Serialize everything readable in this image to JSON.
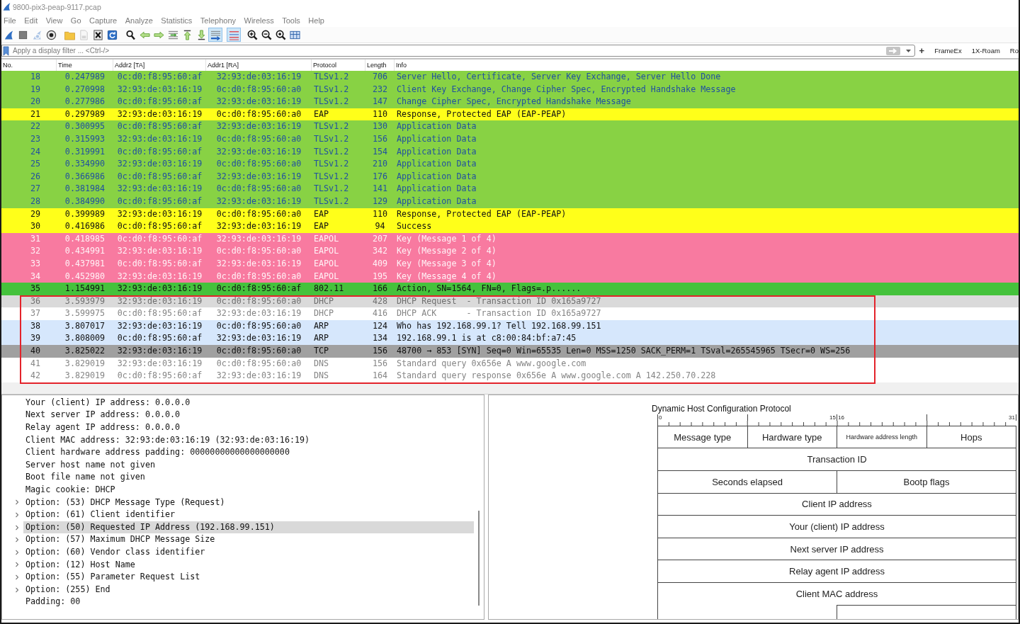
{
  "window": {
    "title": "9800-pix3-peap-9117.pcap"
  },
  "menu": [
    "File",
    "Edit",
    "View",
    "Go",
    "Capture",
    "Analyze",
    "Statistics",
    "Telephony",
    "Wireless",
    "Tools",
    "Help"
  ],
  "toolbar": [
    [
      {
        "on": false,
        "disabled": false
      },
      {
        "on": false,
        "disabled": false
      },
      {
        "on": false,
        "disabled": true
      },
      {
        "on": false,
        "disabled": false
      }
    ],
    [
      {
        "on": false,
        "disabled": false
      },
      {
        "on": false,
        "disabled": true
      },
      {
        "on": false,
        "disabled": false
      },
      {
        "on": false,
        "disabled": false
      }
    ],
    [
      {
        "on": false,
        "disabled": false
      },
      {
        "on": false,
        "disabled": false
      },
      {
        "on": false,
        "disabled": false
      },
      {
        "on": false,
        "disabled": false
      },
      {
        "on": false,
        "disabled": false
      },
      {
        "on": false,
        "disabled": false
      },
      {
        "on": true,
        "disabled": false
      }
    ],
    [
      {
        "on": true,
        "disabled": false
      }
    ],
    [
      {
        "on": false,
        "disabled": false
      },
      {
        "on": false,
        "disabled": false
      },
      {
        "on": false,
        "disabled": false
      },
      {
        "on": false,
        "disabled": false
      }
    ]
  ],
  "filter": {
    "placeholder": "Apply a display filter ... <Ctrl-/>",
    "add_button": "+",
    "buttons": [
      "FrameEx",
      "1X-Roam",
      "Ro"
    ]
  },
  "packet_list": {
    "columns": [
      "No.",
      "Time",
      "Addr2 [TA]",
      "Addr1 [RA]",
      "Protocol",
      "Length",
      "Info"
    ],
    "rows": [
      {
        "cells": [
          "18",
          "0.247989",
          "0c:d0:f8:95:60:af",
          "32:93:de:03:16:19",
          "TLSv1.2",
          "706",
          "Server Hello, Certificate, Server Key Exchange, Server Hello Done"
        ],
        "color": "#88d244",
        "selected": false
      },
      {
        "cells": [
          "19",
          "0.270998",
          "32:93:de:03:16:19",
          "0c:d0:f8:95:60:a0",
          "TLSv1.2",
          "232",
          "Client Key Exchange, Change Cipher Spec, Encrypted Handshake Message"
        ],
        "color": "#88d244",
        "selected": false
      },
      {
        "cells": [
          "20",
          "0.277986",
          "0c:d0:f8:95:60:af",
          "32:93:de:03:16:19",
          "TLSv1.2",
          "147",
          "Change Cipher Spec, Encrypted Handshake Message"
        ],
        "color": "#88d244",
        "selected": false
      },
      {
        "cells": [
          "21",
          "0.297989",
          "32:93:de:03:16:19",
          "0c:d0:f8:95:60:a0",
          "EAP",
          "110",
          "Response, Protected EAP (EAP-PEAP)"
        ],
        "color": "#ffff1a",
        "selected": false
      },
      {
        "cells": [
          "22",
          "0.300995",
          "0c:d0:f8:95:60:af",
          "32:93:de:03:16:19",
          "TLSv1.2",
          "130",
          "Application Data"
        ],
        "color": "#88d244",
        "selected": false
      },
      {
        "cells": [
          "23",
          "0.315993",
          "32:93:de:03:16:19",
          "0c:d0:f8:95:60:a0",
          "TLSv1.2",
          "156",
          "Application Data"
        ],
        "color": "#88d244",
        "selected": false
      },
      {
        "cells": [
          "24",
          "0.319991",
          "0c:d0:f8:95:60:af",
          "32:93:de:03:16:19",
          "TLSv1.2",
          "154",
          "Application Data"
        ],
        "color": "#88d244",
        "selected": false
      },
      {
        "cells": [
          "25",
          "0.334990",
          "32:93:de:03:16:19",
          "0c:d0:f8:95:60:a0",
          "TLSv1.2",
          "210",
          "Application Data"
        ],
        "color": "#88d244",
        "selected": false
      },
      {
        "cells": [
          "26",
          "0.366986",
          "0c:d0:f8:95:60:af",
          "32:93:de:03:16:19",
          "TLSv1.2",
          "176",
          "Application Data"
        ],
        "color": "#88d244",
        "selected": false
      },
      {
        "cells": [
          "27",
          "0.381984",
          "32:93:de:03:16:19",
          "0c:d0:f8:95:60:a0",
          "TLSv1.2",
          "141",
          "Application Data"
        ],
        "color": "#88d244",
        "selected": false
      },
      {
        "cells": [
          "28",
          "0.384990",
          "0c:d0:f8:95:60:af",
          "32:93:de:03:16:19",
          "TLSv1.2",
          "129",
          "Application Data"
        ],
        "color": "#88d244",
        "selected": false
      },
      {
        "cells": [
          "29",
          "0.399989",
          "32:93:de:03:16:19",
          "0c:d0:f8:95:60:a0",
          "EAP",
          "110",
          "Response, Protected EAP (EAP-PEAP)"
        ],
        "color": "#ffff1a",
        "selected": false
      },
      {
        "cells": [
          "30",
          "0.416986",
          "0c:d0:f8:95:60:af",
          "32:93:de:03:16:19",
          "EAP",
          "94",
          "Success"
        ],
        "color": "#ffff1a",
        "selected": false
      },
      {
        "cells": [
          "31",
          "0.418985",
          "0c:d0:f8:95:60:af",
          "32:93:de:03:16:19",
          "EAPOL",
          "207",
          "Key (Message 1 of 4)"
        ],
        "color": "#f87aa0",
        "selected": false
      },
      {
        "cells": [
          "32",
          "0.434991",
          "32:93:de:03:16:19",
          "0c:d0:f8:95:60:a0",
          "EAPOL",
          "342",
          "Key (Message 2 of 4)"
        ],
        "color": "#f87aa0",
        "selected": false
      },
      {
        "cells": [
          "33",
          "0.437981",
          "0c:d0:f8:95:60:af",
          "32:93:de:03:16:19",
          "EAPOL",
          "409",
          "Key (Message 3 of 4)"
        ],
        "color": "#f87aa0",
        "selected": false
      },
      {
        "cells": [
          "34",
          "0.452980",
          "32:93:de:03:16:19",
          "0c:d0:f8:95:60:a0",
          "EAPOL",
          "195",
          "Key (Message 4 of 4)"
        ],
        "color": "#f87aa0",
        "selected": false
      },
      {
        "cells": [
          "35",
          "1.154991",
          "32:93:de:03:16:19",
          "0c:d0:f8:95:60:af",
          "802.11",
          "166",
          "Action, SN=1564, FN=0, Flags=.p......"
        ],
        "color": "#45c23c",
        "selected": false
      }
    ],
    "framed_rows": [
      {
        "cells": [
          "36",
          "3.593979",
          "32:93:de:03:16:19",
          "0c:d0:f8:95:60:a0",
          "DHCP",
          "428",
          "DHCP Request  - Transaction ID 0x165a9727"
        ],
        "selected": true
      },
      {
        "cells": [
          "37",
          "3.599975",
          "0c:d0:f8:95:60:af",
          "32:93:de:03:16:19",
          "DHCP",
          "416",
          "DHCP ACK      - Transaction ID 0x165a9727"
        ],
        "color": "#ffffff",
        "selected": false
      },
      {
        "cells": [
          "38",
          "3.807017",
          "32:93:de:03:16:19",
          "0c:d0:f8:95:60:a0",
          "ARP",
          "124",
          "Who has 192.168.99.1? Tell 192.168.99.151"
        ],
        "color": "#d6e7fc",
        "selected": false
      },
      {
        "cells": [
          "39",
          "3.808009",
          "0c:d0:f8:95:60:af",
          "32:93:de:03:16:19",
          "ARP",
          "134",
          "192.168.99.1 is at c8:00:84:bf:a7:45"
        ],
        "color": "#d6e7fc",
        "selected": false
      },
      {
        "cells": [
          "40",
          "3.825022",
          "32:93:de:03:16:19",
          "0c:d0:f8:95:60:a0",
          "TCP",
          "156",
          "48700 → 853 [SYN] Seq=0 Win=65535 Len=0 MSS=1250 SACK_PERM=1 TSval=265545965 TSecr=0 WS=256"
        ],
        "color": "#a0a0a0",
        "selected": false
      },
      {
        "cells": [
          "41",
          "3.829019",
          "32:93:de:03:16:19",
          "0c:d0:f8:95:60:a0",
          "DNS",
          "156",
          "Standard query 0x656e A www.google.com"
        ],
        "color": "#ffffff",
        "selected": false
      },
      {
        "cells": [
          "42",
          "3.829019",
          "0c:d0:f8:95:60:af",
          "32:93:de:03:16:19",
          "DNS",
          "164",
          "Standard query response 0x656e A www.google.com A 142.250.70.228"
        ],
        "color": "#ffffff",
        "selected": false
      }
    ]
  },
  "details": [
    {
      "text": "Your (client) IP address: 0.0.0.0",
      "kind": "leaf",
      "selected": false
    },
    {
      "text": "Next server IP address: 0.0.0.0",
      "kind": "leaf",
      "selected": false
    },
    {
      "text": "Relay agent IP address: 0.0.0.0",
      "kind": "leaf",
      "selected": false
    },
    {
      "text": "Client MAC address: 32:93:de:03:16:19 (32:93:de:03:16:19)",
      "kind": "leaf",
      "selected": false
    },
    {
      "text": "Client hardware address padding: 00000000000000000000",
      "kind": "leaf",
      "selected": false
    },
    {
      "text": "Server host name not given",
      "kind": "leaf",
      "selected": false
    },
    {
      "text": "Boot file name not given",
      "kind": "leaf",
      "selected": false
    },
    {
      "text": "Magic cookie: DHCP",
      "kind": "leaf",
      "selected": false
    },
    {
      "text": "Option: (53) DHCP Message Type (Request)",
      "kind": "node",
      "expanded": false,
      "selected": false
    },
    {
      "text": "Option: (61) Client identifier",
      "kind": "node",
      "expanded": false,
      "selected": false
    },
    {
      "text": "Option: (50) Requested IP Address (192.168.99.151)",
      "kind": "node",
      "expanded": false,
      "selected": true
    },
    {
      "text": "Option: (57) Maximum DHCP Message Size",
      "kind": "node",
      "expanded": false,
      "selected": false
    },
    {
      "text": "Option: (60) Vendor class identifier",
      "kind": "node",
      "expanded": false,
      "selected": false
    },
    {
      "text": "Option: (12) Host Name",
      "kind": "node",
      "expanded": false,
      "selected": false
    },
    {
      "text": "Option: (55) Parameter Request List",
      "kind": "node",
      "expanded": false,
      "selected": false
    },
    {
      "text": "Option: (255) End",
      "kind": "node",
      "expanded": false,
      "selected": false
    },
    {
      "text": "Padding: 00",
      "kind": "leaf",
      "selected": false
    }
  ],
  "diagram": {
    "title": "Dynamic Host Configuration Protocol",
    "ruler": [
      "0",
      "15",
      "16",
      "31"
    ],
    "rows": [
      [
        {
          "label": "Message type",
          "kind": "byte"
        },
        {
          "label": "Hardware type",
          "kind": "byte"
        },
        {
          "label": "Hardware address length",
          "kind": "byte"
        },
        {
          "label": "Hops",
          "kind": "byte"
        }
      ],
      [
        {
          "label": "Transaction ID",
          "kind": "word"
        }
      ],
      [
        {
          "label": "Seconds elapsed",
          "kind": "half"
        },
        {
          "label": "Bootp flags",
          "kind": "half"
        }
      ],
      [
        {
          "label": "Client IP address",
          "kind": "word"
        }
      ],
      [
        {
          "label": "Your (client) IP address",
          "kind": "word"
        }
      ],
      [
        {
          "label": "Next server IP address",
          "kind": "word"
        }
      ],
      [
        {
          "label": "Relay agent IP address",
          "kind": "word"
        }
      ],
      [
        {
          "label": "Client MAC address",
          "kind": "word"
        }
      ],
      [
        {
          "kind": "half-continued"
        },
        {
          "kind": "half"
        }
      ]
    ]
  }
}
